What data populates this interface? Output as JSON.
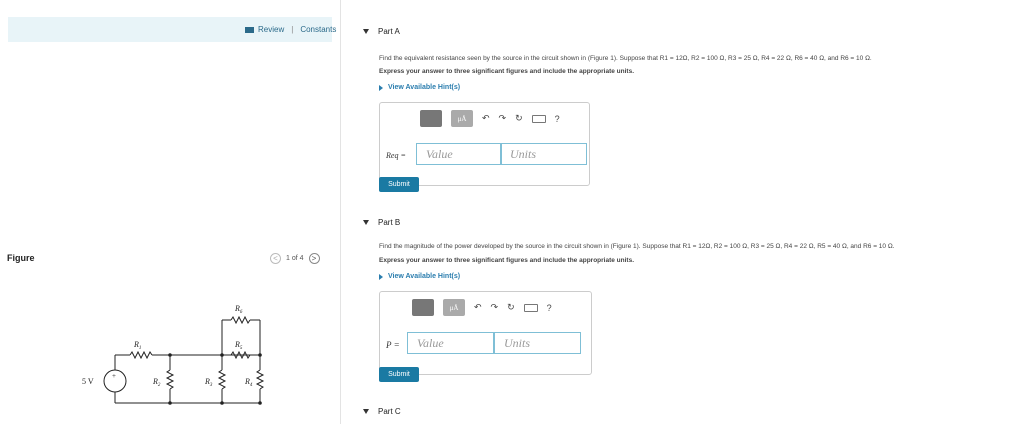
{
  "left_panel": {
    "review_label": "Review",
    "separator": "|",
    "constants_label": "Constants",
    "figure_label": "Figure",
    "pager": {
      "prev": "<",
      "text": "1 of 4",
      "next": ">"
    }
  },
  "circuit": {
    "source_label": "5 V",
    "plus": "+",
    "r1": "R",
    "r1_sub": "1",
    "r2": "R",
    "r2_sub": "2",
    "r3": "R",
    "r3_sub": "3",
    "r4": "R",
    "r4_sub": "4",
    "r5": "R",
    "r5_sub": "5",
    "r6": "R",
    "r6_sub": "6"
  },
  "part_a": {
    "title": "Part A",
    "question": "Find the equivalent resistance seen by the source in the circuit shown in (Figure 1). Suppose that R1 = 12Ω, R2 = 100 Ω, R3 = 25 Ω, R4 = 22 Ω, R6 = 40 Ω, and R6 = 10 Ω.",
    "instructions": "Express your answer to three significant figures and include the appropriate units.",
    "hint": "View Available Hint(s)",
    "eq_label": "Req =",
    "value_placeholder": "Value",
    "units_placeholder": "Units",
    "submit": "Submit"
  },
  "part_b": {
    "title": "Part B",
    "question": "Find the magnitude of the power developed by the source in the circuit shown in (Figure 1). Suppose that R1 = 12Ω, R2 = 100 Ω, R3 = 25 Ω, R4 = 22 Ω, R5 = 40 Ω, and R6 = 10 Ω.",
    "instructions": "Express your answer to three significant figures and include the appropriate units.",
    "hint": "View Available Hint(s)",
    "eq_label": "P =",
    "value_placeholder": "Value",
    "units_placeholder": "Units",
    "submit": "Submit"
  },
  "part_c": {
    "title": "Part C"
  },
  "toolbar": {
    "mu_label": "μÅ",
    "help": "?",
    "undo": "↶",
    "redo": "↷",
    "reset": "↻"
  },
  "colors": {
    "accent": "#1a7aa3",
    "hint": "#2a7dae",
    "review_bg": "#e8f4f8"
  },
  "icons": [
    "template-icon",
    "units-icon",
    "undo-icon",
    "redo-icon",
    "reset-icon",
    "keyboard-icon",
    "help-icon",
    "book-icon"
  ]
}
